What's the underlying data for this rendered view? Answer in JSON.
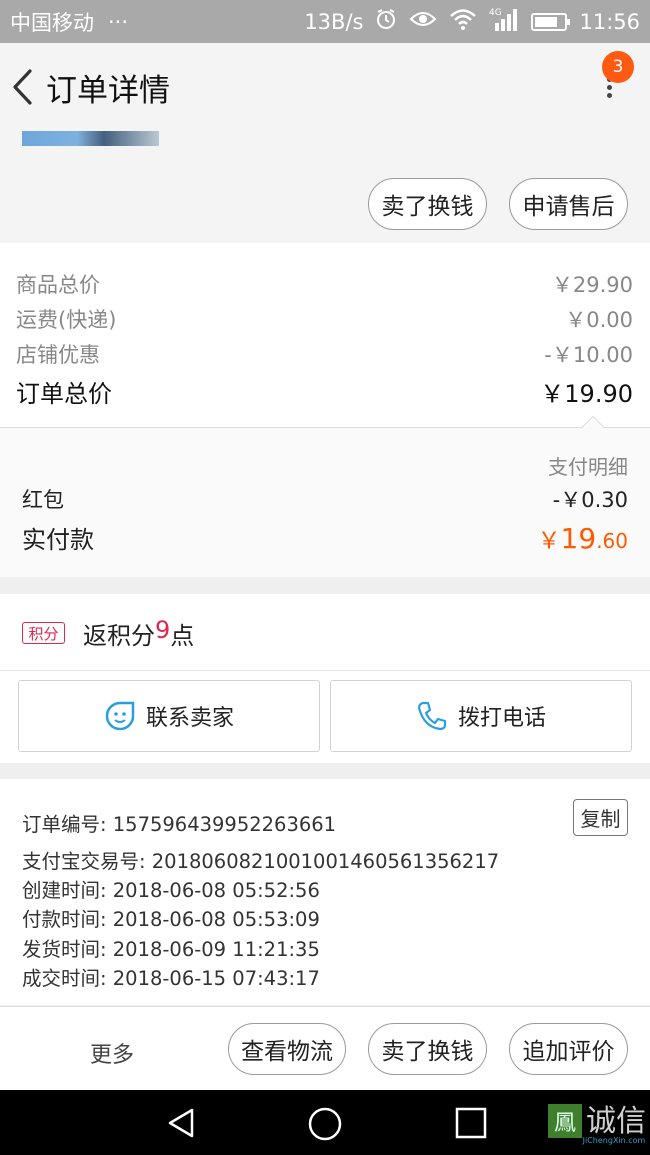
{
  "status_bar": {
    "carrier": "中国移动",
    "dots": "···",
    "speed": "13B/s",
    "network": "4G",
    "time": "11:56"
  },
  "header": {
    "title": "订单详情",
    "badge_count": "3"
  },
  "product_actions": {
    "sell_exchange": "卖了换钱",
    "after_sale": "申请售后"
  },
  "price_details": {
    "goods_total_label": "商品总价",
    "goods_total_value": "￥29.90",
    "shipping_label": "运费(快递)",
    "shipping_value": "￥0.00",
    "discount_label": "店铺优惠",
    "discount_value": "-￥10.00",
    "order_total_label": "订单总价",
    "order_total_value": "￥19.90"
  },
  "payment": {
    "detail_link": "支付明细",
    "red_packet_label": "红包",
    "red_packet_value": "-￥0.30",
    "paid_label": "实付款",
    "paid_symbol": "￥",
    "paid_integer": "19",
    "paid_decimal": ".60",
    "accent_color": "#ff5a00"
  },
  "points": {
    "tag": "积分",
    "prefix": "返积分",
    "number": "9",
    "suffix": "点"
  },
  "contact": {
    "seller_label": "联系卖家",
    "phone_label": "拨打电话"
  },
  "order_info": {
    "copy_label": "复制",
    "rows": [
      "订单编号: 1575964399522636​61",
      "支付宝交易号: 2018060821001001460561356217",
      "创建时间: 2018-06-08 05:52:56",
      "付款时间: 2018-06-08 05:53:09",
      "发货时间: 2018-06-09 11:21:35",
      "成交时间: 2018-06-15 07:43:17"
    ]
  },
  "action_bar": {
    "more": "更多",
    "logistics": "查看物流",
    "sell_exchange": "卖了换钱",
    "add_review": "追加评价"
  },
  "watermark": {
    "text": "诚信",
    "sub": "JiChengXin.com"
  }
}
